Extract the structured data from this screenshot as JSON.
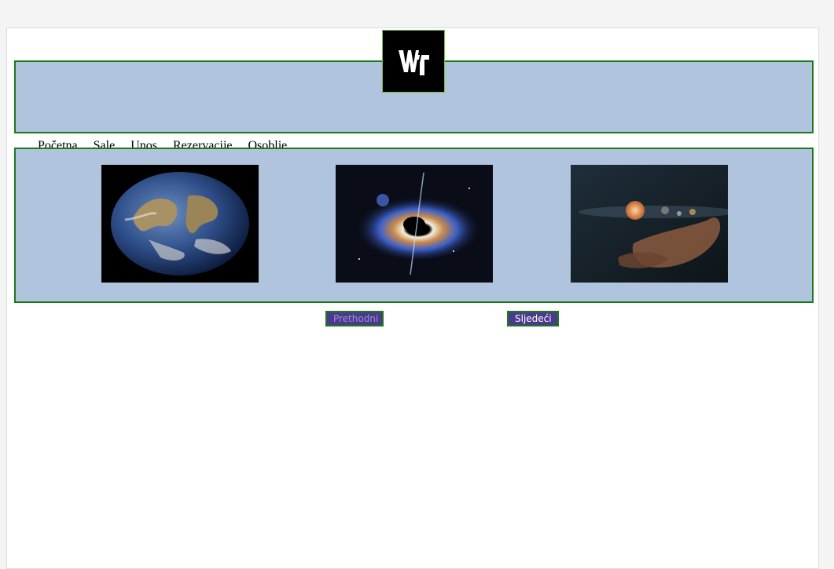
{
  "logo": {
    "text": "WT"
  },
  "nav": {
    "items": [
      {
        "label": "Početna",
        "current": true
      },
      {
        "label": "Sale"
      },
      {
        "label": "Unos"
      },
      {
        "label": "Rezervacije"
      },
      {
        "label": "Osoblje"
      }
    ]
  },
  "gallery": {
    "images": [
      {
        "subject": "earth"
      },
      {
        "subject": "black-hole"
      },
      {
        "subject": "hand-holding-planets"
      }
    ]
  },
  "buttons": {
    "prev_label": "Prethodni",
    "next_label": "Sljedeći"
  },
  "colors": {
    "panel_bg": "#b0c4de",
    "panel_border": "#1a7a1a",
    "button_bg": "#4b3a8c"
  }
}
